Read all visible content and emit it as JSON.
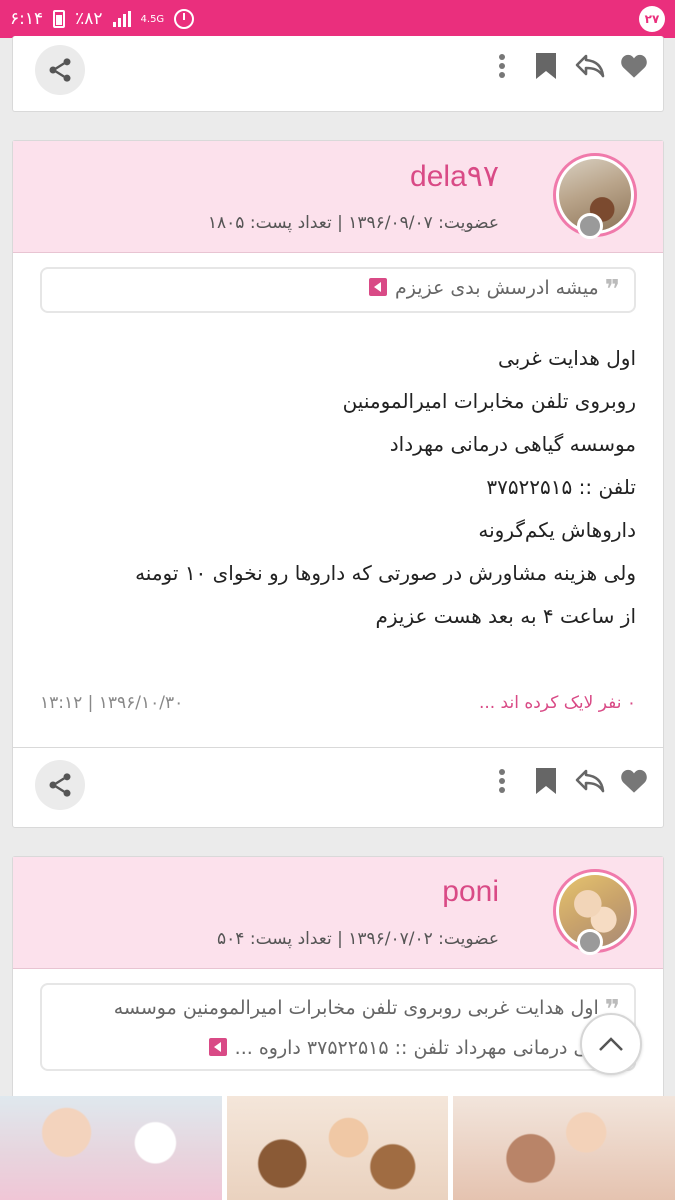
{
  "status_bar": {
    "time": "۶:۱۴",
    "battery": "٪۸۲",
    "network": "4.5G",
    "notifications": "۲۷"
  },
  "posts": [
    {
      "username": "dela۹۷",
      "meta": "عضویت: ۱۳۹۶/۰۹/۰۷ | تعداد پست: ۱۸۰۵",
      "quote": "میشه ادرسش بدی عزیزم",
      "body": [
        "اول هدایت غربی",
        "روبروی تلفن مخابرات امیرالمومنین",
        "موسسه گیاهی درمانی مهرداد",
        "تلفن :: ۳۷۵۲۲۵۱۵",
        "داروهاش یکم‌گرونه",
        "ولی هزینه مشاورش در صورتی که داروها رو نخوای ۱۰ تومنه",
        "از ساعت ۴ به بعد هست عزیزم"
      ],
      "likes": "۰ نفر لایک کرده اند ...",
      "date": "۱۳:۱۲ | ۱۳۹۶/۱۰/۳۰"
    },
    {
      "username": "poni",
      "meta": "عضویت: ۱۳۹۶/۰۷/۰۲ | تعداد پست: ۵۰۴",
      "quote_line1": "اول هدایت غربی روبروی تلفن مخابرات امیرالمومنین موسسه",
      "quote_line2": "گیاهی درمانی مهرداد تلفن :: ۳۷۵۲۲۵۱۵ داروه ..."
    }
  ],
  "icons": [
    "heart-icon",
    "reply-icon",
    "bookmark-icon",
    "more-icon",
    "share-icon",
    "chevron-up-icon"
  ],
  "colors": {
    "accent": "#ea2f7d",
    "header_bg": "#fce1ec",
    "username": "#d94a86"
  }
}
